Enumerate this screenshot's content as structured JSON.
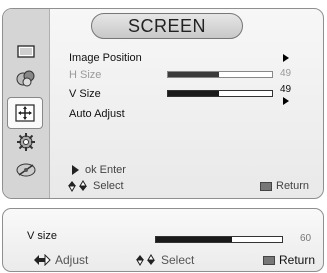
{
  "osd": {
    "title": "SCREEN",
    "menu": [
      {
        "label": "Image Position"
      },
      {
        "label": "H Size",
        "value": "49",
        "level": 0.49
      },
      {
        "label": "V Size",
        "value": "49",
        "level": 0.49
      },
      {
        "label": "Auto Adjust"
      }
    ],
    "hints": {
      "enter": "ok Enter",
      "select": "Select",
      "return": "Return"
    }
  },
  "status_bar": {
    "label": "V size",
    "value": "60",
    "level": 0.6,
    "adjust": "Adjust",
    "select": "Select",
    "return": "Return"
  }
}
